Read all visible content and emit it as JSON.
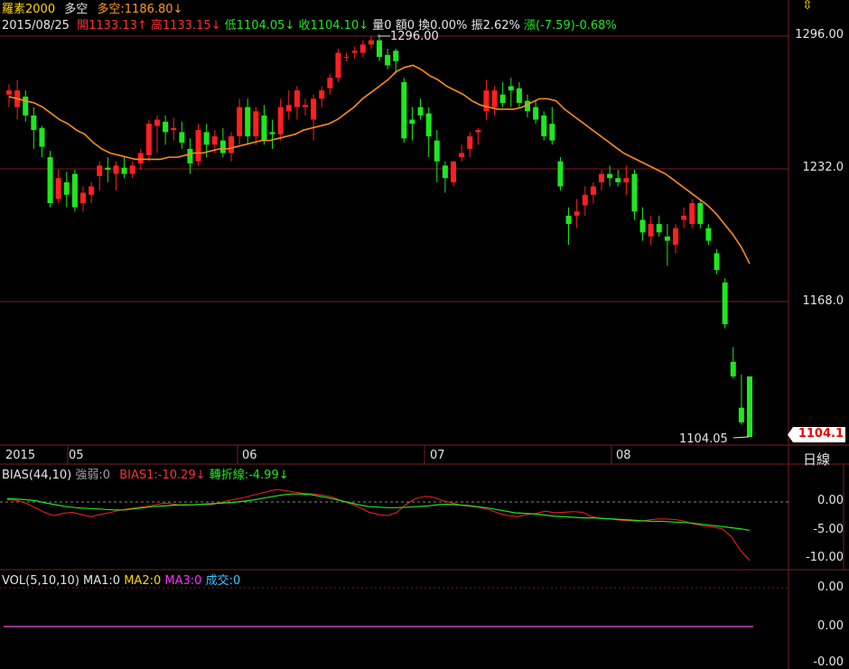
{
  "header": {
    "name": "羅素2000",
    "direction": "多空",
    "direction_value": "多空:1186.80↓",
    "date": "2015/08/25",
    "open": "開1133.13↑",
    "high": "高1133.15↓",
    "low": "低1104.05↓",
    "close": "收1104.10↓",
    "volume": "量0",
    "amount": "額0",
    "turnover": "換0.00%",
    "amplitude": "振2.62%",
    "change": "漲(-7.59)-0.68%"
  },
  "top_right_icon": "sort-arrows-icon",
  "price_axis": {
    "ticks": [
      "1296.00",
      "1232.0",
      "1168.0"
    ],
    "last_price_tag": "1104.1",
    "period": "日線"
  },
  "date_axis": {
    "labels": [
      "2015",
      "05",
      "06",
      "07",
      "08"
    ]
  },
  "annotations": {
    "max_label": "1296.00",
    "min_label": "1104.05"
  },
  "bias_panel": {
    "title": "BIAS(44,10)",
    "strength": "強弱:0",
    "bias1": "BIAS1:-10.29↓",
    "turn": "轉折線:-4.99↓",
    "ticks": [
      "0.00",
      "-5.00",
      "-10.00"
    ]
  },
  "vol_panel": {
    "title": "VOL(5,10,10)",
    "ma1": "MA1:0",
    "ma2": "MA2:0",
    "ma3": "MA3:0",
    "deals": "成交:0",
    "ticks": [
      "0.00",
      "0.00",
      "-0.00"
    ]
  },
  "colors": {
    "up": "#ff2020",
    "down": "#1ee81e",
    "ma": "#ff8c1a",
    "bias1": "#ff2020",
    "turn": "#1ee81e",
    "grid": "#7a1e1e",
    "vol_line": "#cc44cc"
  },
  "chart_data": {
    "type": "candlestick",
    "y_range": [
      1100,
      1305
    ],
    "candles": [
      {
        "o": 1268,
        "h": 1273,
        "l": 1262,
        "c": 1270
      },
      {
        "o": 1262,
        "h": 1275,
        "l": 1256,
        "c": 1270
      },
      {
        "o": 1267,
        "h": 1270,
        "l": 1255,
        "c": 1258
      },
      {
        "o": 1258,
        "h": 1262,
        "l": 1242,
        "c": 1251
      },
      {
        "o": 1252,
        "h": 1253,
        "l": 1238,
        "c": 1243
      },
      {
        "o": 1238,
        "h": 1241,
        "l": 1214,
        "c": 1216
      },
      {
        "o": 1218,
        "h": 1232,
        "l": 1216,
        "c": 1228
      },
      {
        "o": 1226,
        "h": 1231,
        "l": 1214,
        "c": 1220
      },
      {
        "o": 1230,
        "h": 1232,
        "l": 1212,
        "c": 1214
      },
      {
        "o": 1216,
        "h": 1224,
        "l": 1212,
        "c": 1221
      },
      {
        "o": 1220,
        "h": 1226,
        "l": 1216,
        "c": 1224
      },
      {
        "o": 1229,
        "h": 1236,
        "l": 1222,
        "c": 1234
      },
      {
        "o": 1233,
        "h": 1238,
        "l": 1226,
        "c": 1232
      },
      {
        "o": 1230,
        "h": 1236,
        "l": 1222,
        "c": 1234
      },
      {
        "o": 1233,
        "h": 1238,
        "l": 1228,
        "c": 1230
      },
      {
        "o": 1230,
        "h": 1236,
        "l": 1228,
        "c": 1234
      },
      {
        "o": 1235,
        "h": 1242,
        "l": 1232,
        "c": 1240
      },
      {
        "o": 1239,
        "h": 1256,
        "l": 1236,
        "c": 1254
      },
      {
        "o": 1253,
        "h": 1258,
        "l": 1240,
        "c": 1256
      },
      {
        "o": 1255,
        "h": 1258,
        "l": 1244,
        "c": 1250
      },
      {
        "o": 1251,
        "h": 1257,
        "l": 1246,
        "c": 1252
      },
      {
        "o": 1250,
        "h": 1255,
        "l": 1242,
        "c": 1245
      },
      {
        "o": 1242,
        "h": 1247,
        "l": 1230,
        "c": 1235
      },
      {
        "o": 1236,
        "h": 1254,
        "l": 1234,
        "c": 1251
      },
      {
        "o": 1250,
        "h": 1254,
        "l": 1238,
        "c": 1244
      },
      {
        "o": 1244,
        "h": 1251,
        "l": 1240,
        "c": 1248
      },
      {
        "o": 1246,
        "h": 1252,
        "l": 1238,
        "c": 1240
      },
      {
        "o": 1240,
        "h": 1250,
        "l": 1236,
        "c": 1248
      },
      {
        "o": 1248,
        "h": 1266,
        "l": 1244,
        "c": 1262
      },
      {
        "o": 1262,
        "h": 1266,
        "l": 1244,
        "c": 1248
      },
      {
        "o": 1248,
        "h": 1262,
        "l": 1244,
        "c": 1260
      },
      {
        "o": 1258,
        "h": 1263,
        "l": 1244,
        "c": 1246
      },
      {
        "o": 1250,
        "h": 1256,
        "l": 1242,
        "c": 1249
      },
      {
        "o": 1249,
        "h": 1266,
        "l": 1246,
        "c": 1262
      },
      {
        "o": 1260,
        "h": 1270,
        "l": 1256,
        "c": 1263
      },
      {
        "o": 1262,
        "h": 1272,
        "l": 1256,
        "c": 1270
      },
      {
        "o": 1262,
        "h": 1266,
        "l": 1258,
        "c": 1263
      },
      {
        "o": 1256,
        "h": 1268,
        "l": 1246,
        "c": 1266
      },
      {
        "o": 1266,
        "h": 1272,
        "l": 1262,
        "c": 1270
      },
      {
        "o": 1271,
        "h": 1278,
        "l": 1268,
        "c": 1276
      },
      {
        "o": 1276,
        "h": 1290,
        "l": 1274,
        "c": 1288
      },
      {
        "o": 1286,
        "h": 1288,
        "l": 1284,
        "c": 1286
      },
      {
        "o": 1288,
        "h": 1291,
        "l": 1285,
        "c": 1289
      },
      {
        "o": 1288,
        "h": 1294,
        "l": 1286,
        "c": 1292
      },
      {
        "o": 1292,
        "h": 1296,
        "l": 1290,
        "c": 1294
      },
      {
        "o": 1294,
        "h": 1297,
        "l": 1284,
        "c": 1286
      },
      {
        "o": 1287,
        "h": 1290,
        "l": 1280,
        "c": 1282
      },
      {
        "o": 1289,
        "h": 1290,
        "l": 1278,
        "c": 1284
      },
      {
        "o": 1274,
        "h": 1276,
        "l": 1245,
        "c": 1247
      },
      {
        "o": 1256,
        "h": 1262,
        "l": 1246,
        "c": 1254
      },
      {
        "o": 1262,
        "h": 1266,
        "l": 1256,
        "c": 1258
      },
      {
        "o": 1259,
        "h": 1262,
        "l": 1238,
        "c": 1248
      },
      {
        "o": 1246,
        "h": 1251,
        "l": 1226,
        "c": 1236
      },
      {
        "o": 1234,
        "h": 1236,
        "l": 1221,
        "c": 1228
      },
      {
        "o": 1226,
        "h": 1236,
        "l": 1224,
        "c": 1236
      },
      {
        "o": 1238,
        "h": 1244,
        "l": 1236,
        "c": 1240
      },
      {
        "o": 1242,
        "h": 1250,
        "l": 1238,
        "c": 1248
      },
      {
        "o": 1250,
        "h": 1252,
        "l": 1244,
        "c": 1251
      },
      {
        "o": 1260,
        "h": 1275,
        "l": 1256,
        "c": 1270
      },
      {
        "o": 1262,
        "h": 1272,
        "l": 1258,
        "c": 1270
      },
      {
        "o": 1268,
        "h": 1274,
        "l": 1262,
        "c": 1264
      },
      {
        "o": 1272,
        "h": 1276,
        "l": 1262,
        "c": 1270
      },
      {
        "o": 1271,
        "h": 1274,
        "l": 1262,
        "c": 1264
      },
      {
        "o": 1265,
        "h": 1268,
        "l": 1257,
        "c": 1260
      },
      {
        "o": 1262,
        "h": 1265,
        "l": 1254,
        "c": 1256
      },
      {
        "o": 1258,
        "h": 1260,
        "l": 1246,
        "c": 1248
      },
      {
        "o": 1254,
        "h": 1262,
        "l": 1244,
        "c": 1246
      },
      {
        "o": 1236,
        "h": 1238,
        "l": 1222,
        "c": 1224
      },
      {
        "o": 1210,
        "h": 1214,
        "l": 1196,
        "c": 1206
      },
      {
        "o": 1210,
        "h": 1218,
        "l": 1204,
        "c": 1212
      },
      {
        "o": 1215,
        "h": 1224,
        "l": 1210,
        "c": 1220
      },
      {
        "o": 1220,
        "h": 1226,
        "l": 1216,
        "c": 1224
      },
      {
        "o": 1226,
        "h": 1232,
        "l": 1222,
        "c": 1230
      },
      {
        "o": 1230,
        "h": 1234,
        "l": 1224,
        "c": 1228
      },
      {
        "o": 1228,
        "h": 1232,
        "l": 1224,
        "c": 1226
      },
      {
        "o": 1226,
        "h": 1234,
        "l": 1220,
        "c": 1228
      },
      {
        "o": 1230,
        "h": 1232,
        "l": 1208,
        "c": 1212
      },
      {
        "o": 1208,
        "h": 1214,
        "l": 1198,
        "c": 1202
      },
      {
        "o": 1200,
        "h": 1210,
        "l": 1196,
        "c": 1206
      },
      {
        "o": 1206,
        "h": 1210,
        "l": 1200,
        "c": 1202
      },
      {
        "o": 1200,
        "h": 1206,
        "l": 1186,
        "c": 1198
      },
      {
        "o": 1196,
        "h": 1206,
        "l": 1192,
        "c": 1204
      },
      {
        "o": 1208,
        "h": 1214,
        "l": 1204,
        "c": 1210
      },
      {
        "o": 1206,
        "h": 1218,
        "l": 1204,
        "c": 1216
      },
      {
        "o": 1216,
        "h": 1218,
        "l": 1204,
        "c": 1206
      },
      {
        "o": 1204,
        "h": 1206,
        "l": 1196,
        "c": 1198
      },
      {
        "o": 1192,
        "h": 1194,
        "l": 1182,
        "c": 1184
      },
      {
        "o": 1178,
        "h": 1180,
        "l": 1156,
        "c": 1158
      },
      {
        "o": 1140,
        "h": 1147,
        "l": 1132,
        "c": 1133
      },
      {
        "o": 1118,
        "h": 1134,
        "l": 1110,
        "c": 1111
      },
      {
        "o": 1133,
        "h": 1133,
        "l": 1104,
        "c": 1104
      }
    ],
    "ma": [
      1267,
      1266,
      1265,
      1264,
      1262,
      1259,
      1256,
      1254,
      1251,
      1249,
      1245,
      1242,
      1240,
      1239,
      1238,
      1237,
      1237,
      1237,
      1237,
      1238,
      1238,
      1239,
      1240,
      1240,
      1241,
      1242,
      1242,
      1243,
      1244,
      1245,
      1246,
      1246,
      1247,
      1248,
      1249,
      1251,
      1252,
      1253,
      1254,
      1256,
      1259,
      1262,
      1266,
      1269,
      1272,
      1275,
      1279,
      1281,
      1282,
      1280,
      1277,
      1275,
      1272,
      1270,
      1268,
      1265,
      1263,
      1262,
      1261,
      1261,
      1261,
      1262,
      1264,
      1266,
      1266,
      1265,
      1261,
      1258,
      1255,
      1252,
      1249,
      1246,
      1243,
      1240,
      1238,
      1236,
      1234,
      1232,
      1230,
      1227,
      1224,
      1221,
      1218,
      1215,
      1211,
      1206,
      1201,
      1195,
      1187
    ],
    "bias1": [
      0.4,
      0.3,
      -0.2,
      -1.0,
      -1.8,
      -2.4,
      -2.0,
      -1.8,
      -2.2,
      -2.6,
      -2.2,
      -1.9,
      -1.5,
      -1.2,
      -1.0,
      -0.8,
      -0.5,
      -0.2,
      -0.4,
      -0.6,
      -0.5,
      -0.4,
      -0.5,
      -0.1,
      0.3,
      0.6,
      1.0,
      1.4,
      1.8,
      2.2,
      2.0,
      1.7,
      1.5,
      1.4,
      1.2,
      0.9,
      0.2,
      -0.3,
      -1.0,
      -1.8,
      -2.2,
      -2.4,
      -1.8,
      -0.4,
      0.6,
      1.0,
      0.8,
      0.2,
      -0.2,
      -0.6,
      -0.8,
      -1.0,
      -1.4,
      -2.0,
      -2.4,
      -2.6,
      -2.2,
      -2.0,
      -1.6,
      -1.9,
      -1.8,
      -1.7,
      -1.8,
      -2.6,
      -2.9,
      -3.0,
      -3.2,
      -3.3,
      -3.4,
      -3.2,
      -3.0,
      -3.0,
      -3.1,
      -3.4,
      -3.9,
      -4.2,
      -4.4,
      -4.7,
      -6.0,
      -8.5,
      -10.3
    ],
    "turn": [
      0.6,
      0.5,
      0.4,
      0.2,
      -0.2,
      -0.5,
      -0.8,
      -1.0,
      -1.1,
      -1.2,
      -1.3,
      -1.4,
      -1.4,
      -1.2,
      -1.0,
      -0.8,
      -0.7,
      -0.6,
      -0.5,
      -0.5,
      -0.4,
      -0.3,
      -0.2,
      -0.1,
      0.1,
      0.3,
      0.6,
      0.9,
      1.2,
      1.4,
      1.4,
      1.3,
      1.0,
      0.7,
      0.3,
      -0.1,
      -0.5,
      -0.8,
      -0.9,
      -1.0,
      -1.0,
      -0.9,
      -0.8,
      -0.7,
      -0.5,
      -0.4,
      -0.5,
      -0.6,
      -0.8,
      -1.0,
      -1.3,
      -1.6,
      -1.9,
      -2.0,
      -2.1,
      -2.3,
      -2.5,
      -2.6,
      -2.7,
      -2.8,
      -2.8,
      -2.9,
      -3.0,
      -3.1,
      -3.2,
      -3.3,
      -3.4,
      -3.4,
      -3.5,
      -3.6,
      -3.7,
      -3.9,
      -4.1,
      -4.3,
      -4.5,
      -4.7,
      -4.99
    ]
  }
}
